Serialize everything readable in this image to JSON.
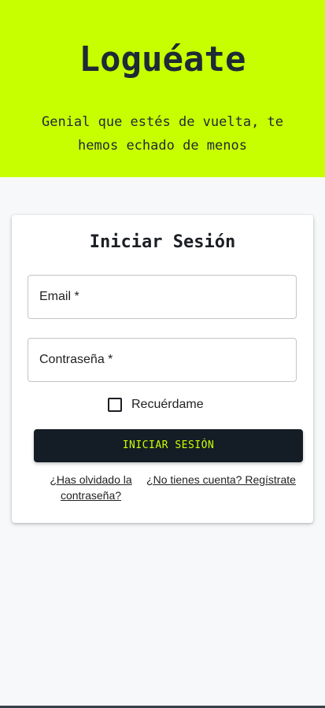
{
  "hero": {
    "title": "Loguéate",
    "subtitle": "Genial que estés de vuelta, te hemos echado de menos"
  },
  "login_card": {
    "title": "Iniciar Sesión",
    "email_label": "Email *",
    "email_value": "",
    "password_label": "Contraseña *",
    "password_value": "",
    "remember_label": "Recuérdame",
    "remember_checked": false,
    "submit_label": "INICIAR SESIÓN",
    "forgot_link": "¿Has olvidado la contraseña?",
    "register_link": "¿No tienes cuenta? Regístrate"
  },
  "colors": {
    "accent": "#c8ff00",
    "dark": "#141d25",
    "background": "#f7f8fa"
  }
}
